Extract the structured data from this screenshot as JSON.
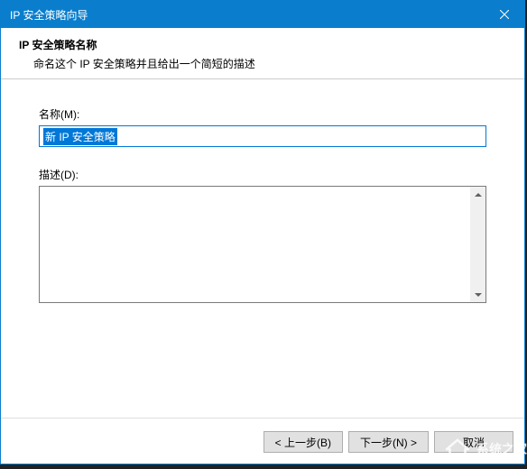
{
  "titlebar": {
    "title": "IP 安全策略向导"
  },
  "header": {
    "title": "IP 安全策略名称",
    "subtitle": "命名这个 IP 安全策略并且给出一个简短的描述"
  },
  "fields": {
    "name": {
      "label": "名称(M):",
      "value": "新 IP 安全策略"
    },
    "description": {
      "label": "描述(D):",
      "value": ""
    }
  },
  "buttons": {
    "back": "< 上一步(B)",
    "next": "下一步(N) >",
    "cancel": "取消"
  },
  "watermark": {
    "text": "系统之家"
  }
}
